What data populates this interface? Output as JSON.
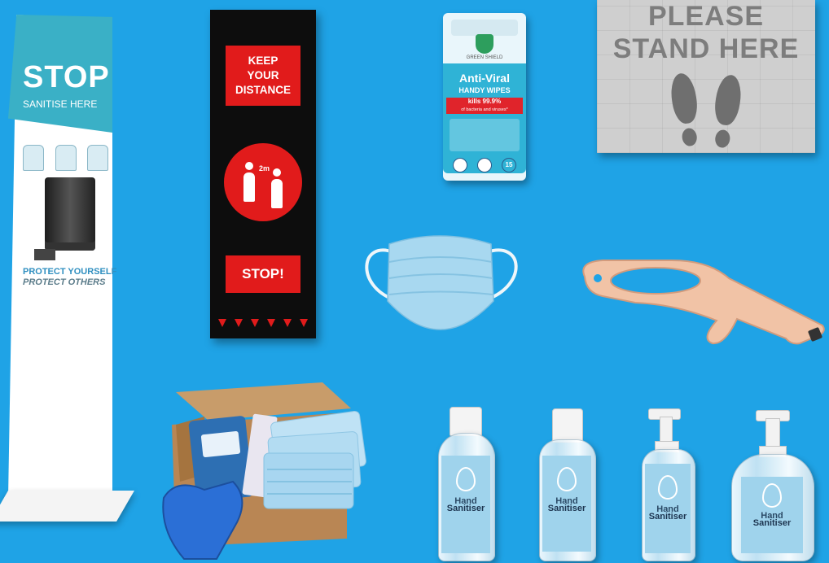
{
  "stand": {
    "title": "STOP",
    "subtitle": "SANITISE HERE",
    "line1": "PROTECT YOURSELF",
    "line2": "PROTECT OTHERS"
  },
  "banner": {
    "keep_line1": "KEEP",
    "keep_line2": "YOUR",
    "keep_line3": "DISTANCE",
    "distance": "2m",
    "stop": "STOP!"
  },
  "wipes": {
    "brand": "GREEN SHIELD",
    "title": "Anti-Viral",
    "subtitle": "HANDY WIPES",
    "kills": "kills 99.9%",
    "kills_sub": "of bacteria and viruses*",
    "count": "15"
  },
  "floor_sticker": {
    "line1": "PLEASE",
    "line2": "STAND HERE"
  },
  "sanitiser": {
    "word1": "Hand",
    "word2": "Sanitiser"
  },
  "colors": {
    "background": "#1fa3e6",
    "banner_red": "#e11b1b",
    "stand_teal": "#3ab0c6"
  }
}
